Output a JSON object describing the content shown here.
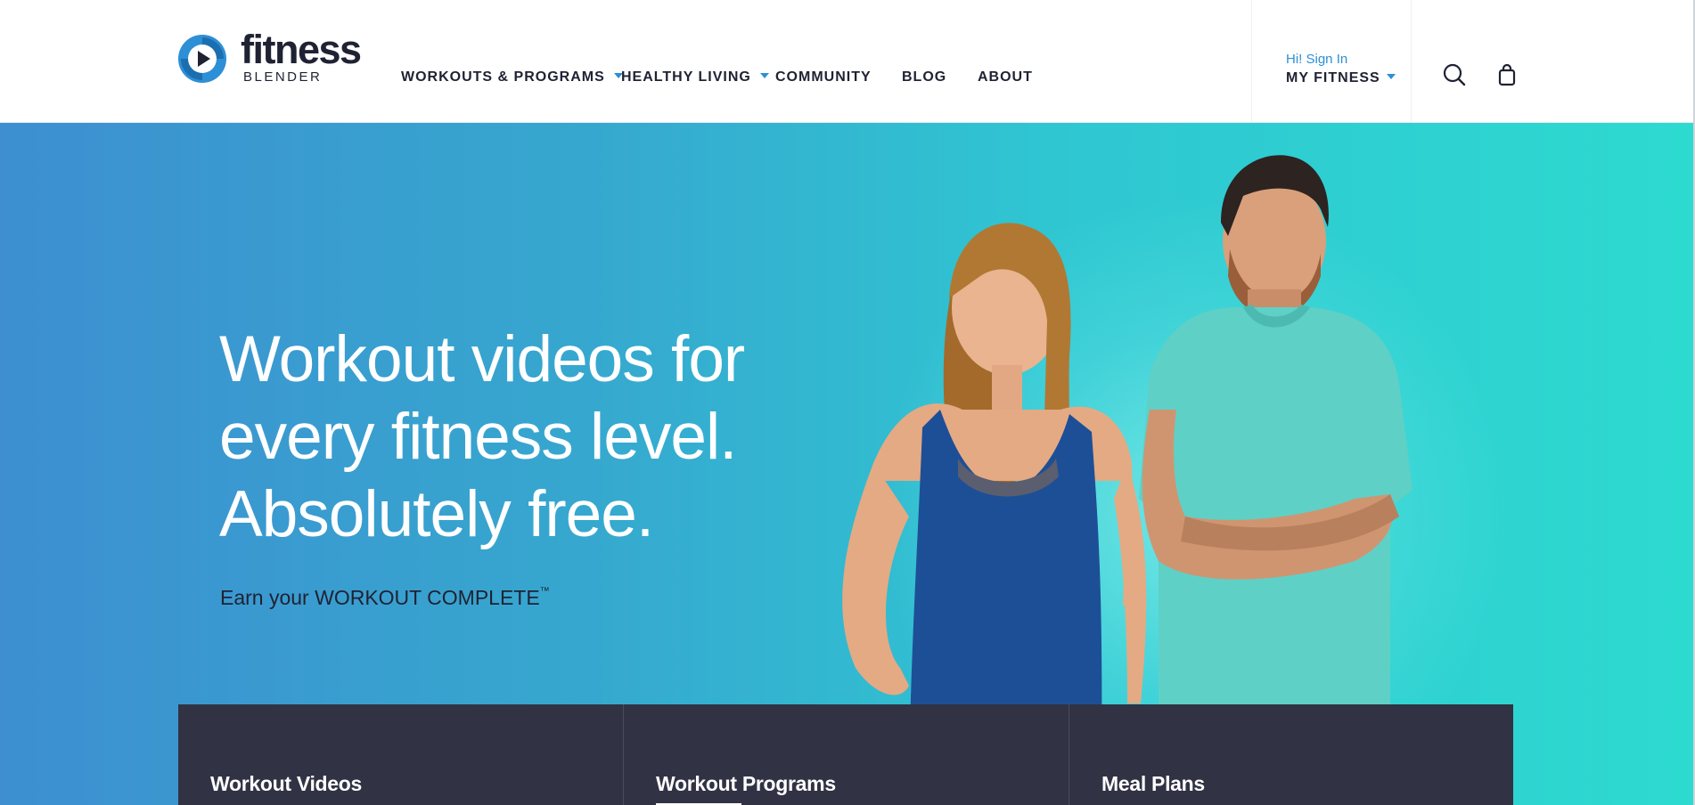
{
  "brand": {
    "name": "fitness",
    "sub": "BLENDER",
    "accent": "#2d8fd5",
    "dark": "#1f2233"
  },
  "nav": {
    "items": [
      {
        "label": "WORKOUTS & PROGRAMS",
        "dropdown": true
      },
      {
        "label": "HEALTHY LIVING",
        "dropdown": true
      },
      {
        "label": "COMMUNITY",
        "dropdown": false
      },
      {
        "label": "BLOG",
        "dropdown": false
      },
      {
        "label": "ABOUT",
        "dropdown": false
      }
    ]
  },
  "account": {
    "greeting": "Hi! Sign In",
    "label": "MY FITNESS"
  },
  "icons": {
    "search": "search-icon",
    "cart": "shopping-bag-icon"
  },
  "hero": {
    "title_lines": [
      "Workout videos for",
      "every fitness level.",
      "Absolutely free."
    ],
    "subtitle": "Earn your WORKOUT COMPLETE",
    "subtitle_mark": "™",
    "gradient": [
      "#3d8fd0",
      "#2ddad0"
    ]
  },
  "cards": [
    {
      "label": "Workout Videos"
    },
    {
      "label": "Workout Programs"
    },
    {
      "label": "Meal Plans"
    }
  ]
}
